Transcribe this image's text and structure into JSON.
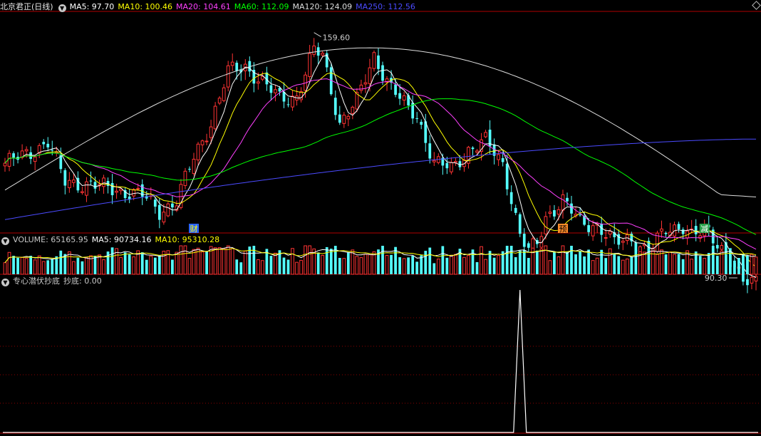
{
  "main": {
    "title": "北京君正(日线)",
    "ma": [
      {
        "label": "MA5: 97.70",
        "color": "#ffffff"
      },
      {
        "label": "MA10: 100.46",
        "color": "#ffff00"
      },
      {
        "label": "MA20: 104.61",
        "color": "#ff40ff"
      },
      {
        "label": "MA60: 112.09",
        "color": "#00ff00"
      },
      {
        "label": "MA120: 124.09",
        "color": "#dddddd"
      },
      {
        "label": "MA250: 112.56",
        "color": "#4b4bff"
      }
    ],
    "high_label": "159.60",
    "low_label": "90.30",
    "markers": [
      {
        "text": "财",
        "bg": "#2a64ff",
        "fg": "#ffff00",
        "index": 44
      },
      {
        "text": "预",
        "bg": "#ff8c2a",
        "fg": "#000000",
        "index": 130
      },
      {
        "text": "减",
        "bg": "#2aa14b",
        "fg": "#ffffff",
        "index": 163
      }
    ]
  },
  "volume": {
    "header": [
      {
        "label": "VOLUME: 65165.95",
        "color": "#c8c8c8"
      },
      {
        "label": "MA5: 90734.16",
        "color": "#ffffff"
      },
      {
        "label": "MA10: 95310.28",
        "color": "#ffff00"
      }
    ]
  },
  "indicator": {
    "header": [
      {
        "label": "专心潜伏抄底",
        "color": "#c8c8c8"
      },
      {
        "label": "抄底: 0.00",
        "color": "#c8c8c8"
      }
    ]
  },
  "colors": {
    "up": "#ff3333",
    "down": "#54ffff",
    "grid": "#8b0000",
    "sep": "#b00000"
  },
  "chart_data": [
    {
      "type": "candlestick",
      "title": "北京君正(日线)",
      "ylim": [
        88,
        166
      ],
      "n_bars": 176,
      "anchors_close": [
        [
          0,
          110
        ],
        [
          6,
          114
        ],
        [
          10,
          118
        ],
        [
          14,
          103
        ],
        [
          20,
          102
        ],
        [
          26,
          100
        ],
        [
          32,
          98
        ],
        [
          36,
          92
        ],
        [
          40,
          96
        ],
        [
          44,
          112
        ],
        [
          48,
          125
        ],
        [
          52,
          144
        ],
        [
          56,
          146
        ],
        [
          60,
          140
        ],
        [
          64,
          134
        ],
        [
          68,
          135
        ],
        [
          72,
          152
        ],
        [
          74,
          150
        ],
        [
          78,
          125
        ],
        [
          82,
          133
        ],
        [
          86,
          150
        ],
        [
          90,
          138
        ],
        [
          94,
          130
        ],
        [
          96,
          128
        ],
        [
          100,
          110
        ],
        [
          104,
          108
        ],
        [
          108,
          115
        ],
        [
          112,
          118
        ],
        [
          116,
          110
        ],
        [
          118,
          97
        ],
        [
          120,
          83
        ],
        [
          122,
          77
        ],
        [
          124,
          80
        ],
        [
          126,
          90
        ],
        [
          130,
          96
        ],
        [
          134,
          88
        ],
        [
          138,
          87
        ],
        [
          142,
          80
        ],
        [
          146,
          82
        ],
        [
          150,
          77
        ],
        [
          154,
          85
        ],
        [
          158,
          87
        ],
        [
          160,
          83
        ],
        [
          164,
          84
        ],
        [
          168,
          77
        ],
        [
          172,
          65
        ],
        [
          176,
          67
        ]
      ],
      "ma_series": [
        {
          "name": "MA5",
          "color": "#ffffff",
          "last": 97.7
        },
        {
          "name": "MA10",
          "color": "#ffff00",
          "last": 100.46
        },
        {
          "name": "MA20",
          "color": "#ff40ff",
          "last": 104.61
        },
        {
          "name": "MA60",
          "color": "#00ff00",
          "last": 112.09
        },
        {
          "name": "MA120",
          "color": "#dddddd",
          "last": 124.09
        },
        {
          "name": "MA250",
          "color": "#4b4bff",
          "last": 112.56
        }
      ],
      "annotations": [
        {
          "text": "159.60",
          "kind": "high"
        },
        {
          "text": "90.30",
          "kind": "low"
        }
      ]
    },
    {
      "type": "bar",
      "title": "VOLUME",
      "last_value": 65165.95,
      "ma5": 90734.16,
      "ma10": 95310.28
    },
    {
      "type": "line",
      "title": "专心潜伏抄底",
      "series": [
        {
          "name": "抄底",
          "last": 0.0,
          "spike_index": 120,
          "spike_value": 1
        }
      ]
    }
  ]
}
